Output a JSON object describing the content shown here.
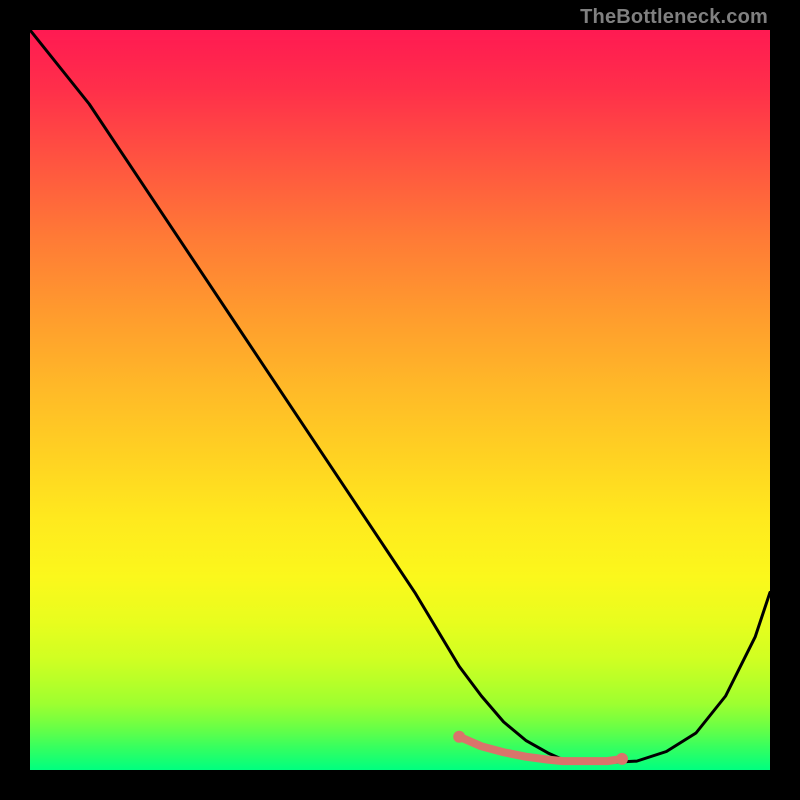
{
  "watermark": "TheBottleneck.com",
  "chart_data": {
    "type": "line",
    "title": "",
    "xlabel": "",
    "ylabel": "",
    "xlim": [
      0,
      100
    ],
    "ylim": [
      0,
      100
    ],
    "grid": false,
    "legend": false,
    "background_gradient": {
      "top": "#ff1a52",
      "mid": "#ffe91e",
      "bottom": "#00ff80"
    },
    "series": [
      {
        "name": "bottleneck-curve",
        "color": "#000000",
        "x": [
          0,
          4,
          8,
          12,
          16,
          20,
          24,
          28,
          32,
          36,
          40,
          44,
          48,
          52,
          55,
          58,
          61,
          64,
          67,
          70,
          72,
          74,
          78,
          82,
          86,
          90,
          94,
          98,
          100
        ],
        "y": [
          100,
          95,
          90,
          84,
          78,
          72,
          66,
          60,
          54,
          48,
          42,
          36,
          30,
          24,
          19,
          14,
          10,
          6.5,
          4,
          2.3,
          1.4,
          1,
          1,
          1.2,
          2.5,
          5,
          10,
          18,
          24
        ]
      },
      {
        "name": "highlight-segment",
        "color": "#d9746b",
        "x": [
          58,
          61,
          64,
          67,
          70,
          72,
          74,
          78,
          80
        ],
        "y": [
          4.5,
          3.2,
          2.4,
          1.8,
          1.4,
          1.2,
          1.2,
          1.2,
          1.5
        ]
      }
    ],
    "markers": [
      {
        "x": 58,
        "y": 4.5,
        "color": "#d9746b"
      },
      {
        "x": 80,
        "y": 1.5,
        "color": "#d9746b"
      }
    ]
  }
}
